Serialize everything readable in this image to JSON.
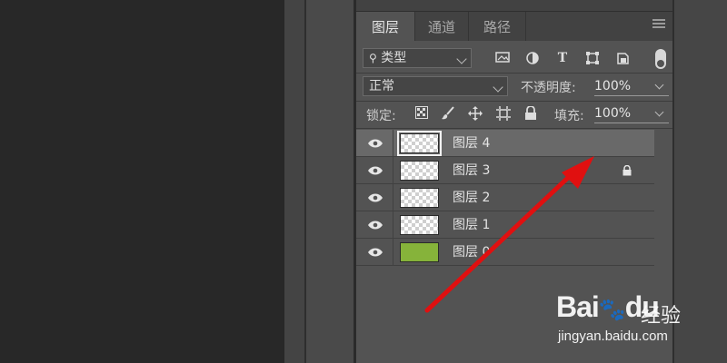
{
  "tabs": [
    {
      "label": "图层",
      "active": true
    },
    {
      "label": "通道",
      "active": false
    },
    {
      "label": "路径",
      "active": false
    }
  ],
  "filter": {
    "label": "类型"
  },
  "blend": {
    "mode": "正常",
    "opacity_label": "不透明度:",
    "opacity_value": "100%"
  },
  "lock_row": {
    "lock_label": "锁定:",
    "fill_label": "填充:",
    "fill_value": "100%"
  },
  "layers": [
    {
      "name": "图层 4",
      "selected": true,
      "locked": false,
      "thumb": "transparent"
    },
    {
      "name": "图层 3",
      "selected": false,
      "locked": true,
      "thumb": "transparent"
    },
    {
      "name": "图层 2",
      "selected": false,
      "locked": false,
      "thumb": "transparent"
    },
    {
      "name": "图层 1",
      "selected": false,
      "locked": false,
      "thumb": "transparent"
    },
    {
      "name": "图层 0",
      "selected": false,
      "locked": false,
      "thumb": "#86b33a"
    }
  ],
  "watermark": {
    "logo": "Bai",
    "logo_tail": "du",
    "brand_cn": "经验",
    "url": "jingyan.baidu.com"
  },
  "colors": {
    "panel_bg": "#535353",
    "selected_row": "#696969",
    "arrow": "#e01010"
  }
}
